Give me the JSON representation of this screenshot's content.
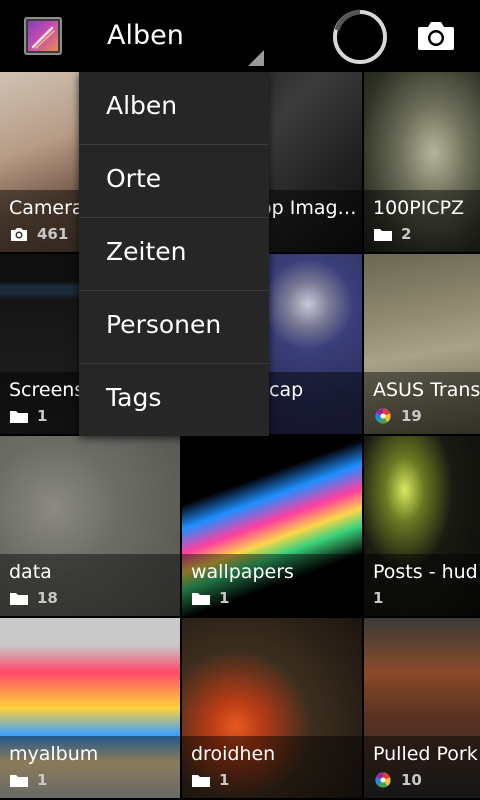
{
  "action_bar": {
    "view_spinner_label": "Alben",
    "app_icon": "gallery-app-icon",
    "progress_icon": "loading-spinner-icon",
    "camera_icon": "camera-icon"
  },
  "dropdown": {
    "items": [
      "Alben",
      "Orte",
      "Zeiten",
      "Personen",
      "Tags"
    ]
  },
  "albums": [
    {
      "title": "Camera",
      "count": "461",
      "source_icon": "camera-icon"
    },
    {
      "title": "op Imag…",
      "count": "",
      "source_icon": ""
    },
    {
      "title": "100PICPZ",
      "count": "2",
      "source_icon": "folder-icon"
    },
    {
      "title": "Screens",
      "count": "1",
      "source_icon": "folder-icon"
    },
    {
      "title": "cap",
      "count": "",
      "source_icon": ""
    },
    {
      "title": "ASUS Trans",
      "count": "19",
      "source_icon": "picasa-icon"
    },
    {
      "title": "data",
      "count": "18",
      "source_icon": "folder-icon"
    },
    {
      "title": "wallpapers",
      "count": "1",
      "source_icon": "folder-icon"
    },
    {
      "title": "Posts - hud",
      "count": "1",
      "source_icon": ""
    },
    {
      "title": "myalbum",
      "count": "1",
      "source_icon": "folder-icon"
    },
    {
      "title": "droidhen",
      "count": "1",
      "source_icon": "folder-icon"
    },
    {
      "title": "Pulled Pork",
      "count": "10",
      "source_icon": "picasa-icon"
    }
  ],
  "colors": {
    "dropdown_bg": "#262626",
    "background": "#000000",
    "accent": "#ffffff"
  }
}
